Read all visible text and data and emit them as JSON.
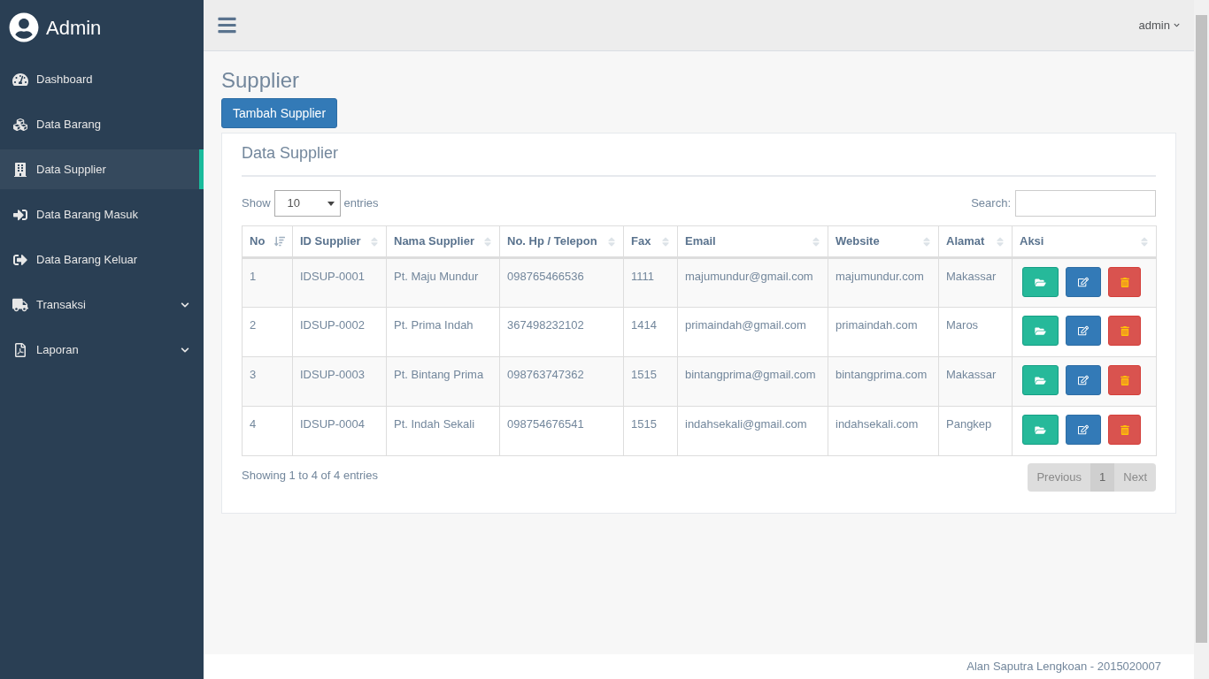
{
  "sidebar": {
    "title": "Admin",
    "items": [
      {
        "label": "Dashboard",
        "selected": false,
        "expandable": false
      },
      {
        "label": "Data Barang",
        "selected": false,
        "expandable": false
      },
      {
        "label": "Data Supplier",
        "selected": true,
        "expandable": false
      },
      {
        "label": "Data Barang Masuk",
        "selected": false,
        "expandable": false
      },
      {
        "label": "Data Barang Keluar",
        "selected": false,
        "expandable": false
      },
      {
        "label": "Transaksi",
        "selected": false,
        "expandable": true
      },
      {
        "label": "Laporan",
        "selected": false,
        "expandable": true
      }
    ]
  },
  "topbar": {
    "user": "admin"
  },
  "page": {
    "title": "Supplier",
    "add_button": "Tambah Supplier"
  },
  "panel": {
    "title": "Data Supplier",
    "length": {
      "label_before": "Show",
      "value": "10",
      "label_after": "entries"
    },
    "search": {
      "label": "Search:"
    },
    "table": {
      "columns": [
        {
          "label": "No",
          "sorted": true
        },
        {
          "label": "ID Supplier",
          "sorted": false
        },
        {
          "label": "Nama Supplier",
          "sorted": false
        },
        {
          "label": "No. Hp / Telepon",
          "sorted": false
        },
        {
          "label": "Fax",
          "sorted": false
        },
        {
          "label": "Email",
          "sorted": false
        },
        {
          "label": "Website",
          "sorted": false
        },
        {
          "label": "Alamat",
          "sorted": false
        },
        {
          "label": "Aksi",
          "sorted": false
        }
      ],
      "rows": [
        [
          "1",
          "IDSUP-0001",
          "Pt. Maju Mundur",
          "098765466536",
          "1111",
          "majumundur@gmail.com",
          "majumundur.com",
          "Makassar"
        ],
        [
          "2",
          "IDSUP-0002",
          "Pt. Prima Indah",
          "367498232102",
          "1414",
          "primaindah@gmail.com",
          "primaindah.com",
          "Maros"
        ],
        [
          "3",
          "IDSUP-0003",
          "Pt. Bintang Prima",
          "098763747362",
          "1515",
          "bintangprima@gmail.com",
          "bintangprima.com",
          "Makassar"
        ],
        [
          "4",
          "IDSUP-0004",
          "Pt. Indah Sekali",
          "098754676541",
          "1515",
          "indahsekali@gmail.com",
          "indahsekali.com",
          "Pangkep"
        ]
      ]
    },
    "info": "Showing 1 to 4 of 4 entries",
    "pagination": {
      "previous": {
        "label": "Previous",
        "disabled": true
      },
      "pages": [
        {
          "label": "1",
          "selected": true
        }
      ],
      "next": {
        "label": "Next",
        "disabled": true
      }
    }
  },
  "footer": "Alan Saputra Lengkoan - 2015020007"
}
